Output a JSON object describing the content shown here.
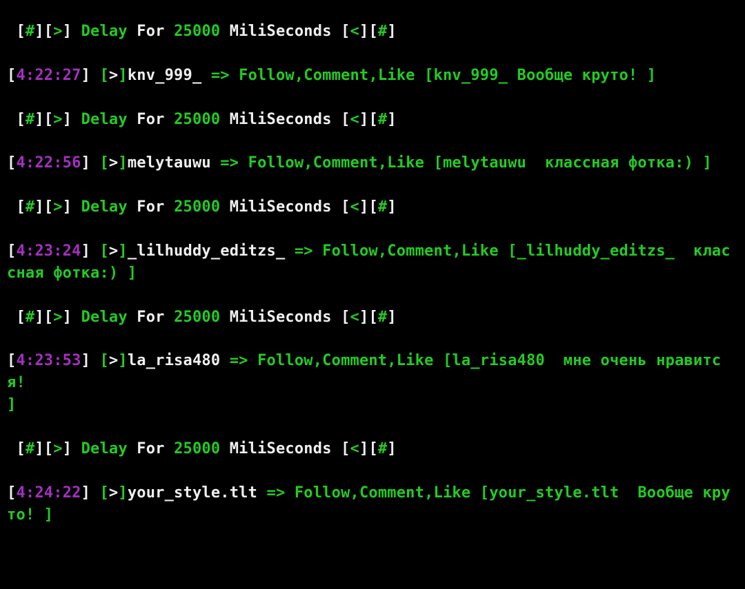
{
  "colors": {
    "green": "#22cc22",
    "magenta": "#a430c0",
    "white": "#f0f0f0",
    "bg": "#000000"
  },
  "delay_template": {
    "prefix1": " [",
    "hash": "#",
    "mid1": "][",
    "arrow_r": ">",
    "mid2": "] ",
    "word_delay": "Delay",
    "word_for": " For ",
    "ms_value": "25000",
    "word_ms": " MiliSeconds ",
    "mid3": "[",
    "arrow_l": "<",
    "mid4": "][",
    "hash2": "#",
    "suffix": "]"
  },
  "entries": [
    {
      "time": "4:22:27",
      "user": "knv_999_",
      "action": "Follow,Comment,Like",
      "echo_user": "knv_999_",
      "comment_lead_spaces": " ",
      "comment": "Вообще круто!",
      "comment_trail": " "
    },
    {
      "time": "4:22:56",
      "user": "melytauwu",
      "action": "Follow,Comment,Like",
      "echo_user": "melytauwu",
      "comment_lead_spaces": "  ",
      "comment": "классная фотка:)",
      "comment_trail": " "
    },
    {
      "time": "4:23:24",
      "user": "_lilhuddy_editzs_",
      "action": "Follow,Comment,Like",
      "echo_user": "_lilhuddy_editzs_",
      "comment_lead_spaces": "  ",
      "comment": "классная фотка:)",
      "comment_trail": " "
    },
    {
      "time": "4:23:53",
      "user": "la_risa480",
      "action": "Follow,Comment,Like",
      "echo_user": "la_risa480",
      "comment_lead_spaces": "  ",
      "comment": "мне очень нравится!\n",
      "comment_trail": ""
    },
    {
      "time": "4:24:22",
      "user": "your_style.tlt",
      "action": "Follow,Comment,Like",
      "echo_user": "your_style.tlt",
      "comment_lead_spaces": "  ",
      "comment": "Вообще круто!",
      "comment_trail": " "
    }
  ],
  "tokens": {
    "lbracket": "[",
    "rbracket": "]",
    "arrow_r": ">",
    "arrow_fat": " => ",
    "space": " "
  }
}
